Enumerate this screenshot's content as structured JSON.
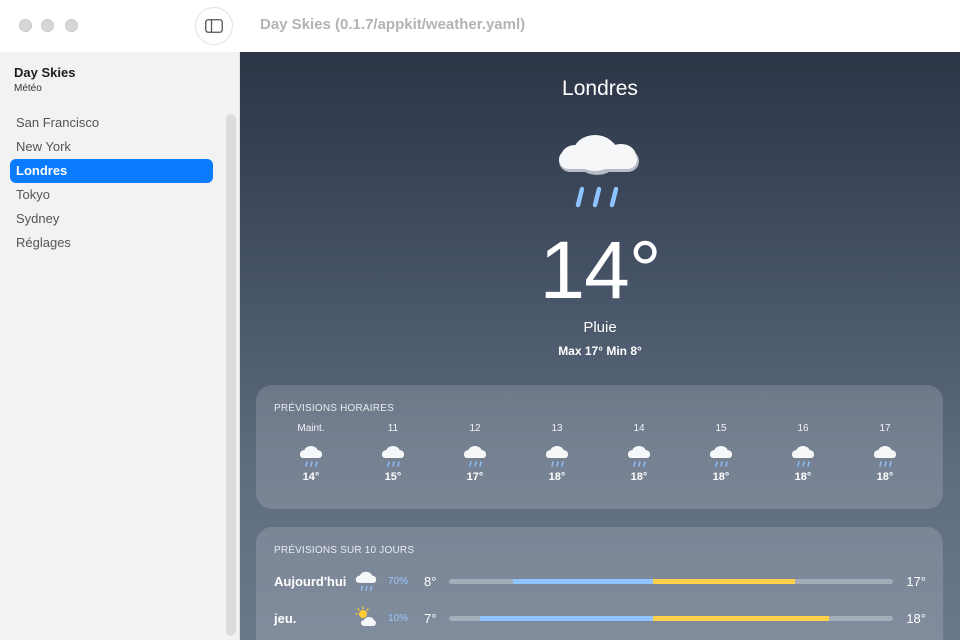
{
  "window": {
    "title": "Day Skies (0.1.7/appkit/weather.yaml)"
  },
  "sidebar": {
    "app_name": "Day Skies",
    "app_subtitle": "Météo",
    "items": [
      {
        "label": "San Francisco",
        "active": false
      },
      {
        "label": "New York",
        "active": false
      },
      {
        "label": "Londres",
        "active": true
      },
      {
        "label": "Tokyo",
        "active": false
      },
      {
        "label": "Sydney",
        "active": false
      },
      {
        "label": "Réglages",
        "active": false
      }
    ]
  },
  "current": {
    "city": "Londres",
    "icon": "cloud-rain-icon",
    "temperature": "14°",
    "condition": "Pluie",
    "high_low": "Max 17° Min 8°"
  },
  "hourly": {
    "title": "PRÉVISIONS HORAIRES",
    "hours": [
      {
        "label": "Maint.",
        "icon": "cloud-rain-icon",
        "temp": "14°"
      },
      {
        "label": "11",
        "icon": "cloud-rain-icon",
        "temp": "15°"
      },
      {
        "label": "12",
        "icon": "cloud-rain-icon",
        "temp": "17°"
      },
      {
        "label": "13",
        "icon": "cloud-rain-icon",
        "temp": "18°"
      },
      {
        "label": "14",
        "icon": "cloud-rain-icon",
        "temp": "18°"
      },
      {
        "label": "15",
        "icon": "cloud-rain-icon",
        "temp": "18°"
      },
      {
        "label": "16",
        "icon": "cloud-rain-icon",
        "temp": "18°"
      },
      {
        "label": "17",
        "icon": "cloud-rain-icon",
        "temp": "18°"
      }
    ]
  },
  "daily": {
    "title": "PRÉVISIONS SUR 10 JOURS",
    "days": [
      {
        "name": "Aujourd'hui",
        "icon": "cloud-rain-icon",
        "precip": "70%",
        "min": "8°",
        "max": "17°",
        "range_start": 0.145,
        "range_mid": 0.46,
        "range_end": 0.78
      },
      {
        "name": "jeu.",
        "icon": "sun-cloud-icon",
        "precip": "10%",
        "min": "7°",
        "max": "18°",
        "range_start": 0.07,
        "range_mid": 0.46,
        "range_end": 0.855
      }
    ]
  },
  "colors": {
    "accent": "#0a7aff",
    "rain": "#8ec4ff",
    "range_cool": "#8ec4ff",
    "range_warm": "#ffd14a"
  }
}
